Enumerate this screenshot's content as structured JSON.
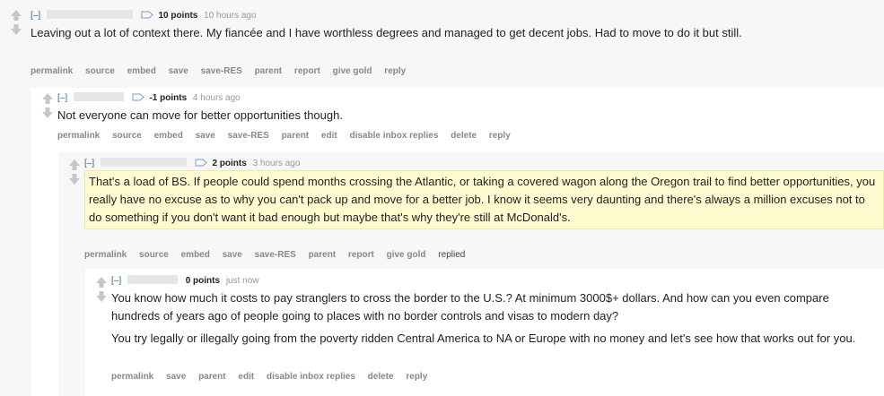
{
  "comments": [
    {
      "collapse": "[–]",
      "points": "10 points",
      "time": "10 hours ago",
      "paragraphs": [
        "Leaving out a lot of context there. My fiancée and I have worthless degrees and managed to get decent jobs. Had to move to do it but still."
      ],
      "buttons": [
        "permalink",
        "source",
        "embed",
        "save",
        "save-RES",
        "parent",
        "report",
        "give gold",
        "reply"
      ]
    },
    {
      "collapse": "[–]",
      "points": "-1 points",
      "time": "4 hours ago",
      "paragraphs": [
        "Not everyone can move for better opportunities though."
      ],
      "buttons": [
        "permalink",
        "source",
        "embed",
        "save",
        "save-RES",
        "parent",
        "edit",
        "disable inbox replies",
        "delete",
        "reply"
      ]
    },
    {
      "collapse": "[–]",
      "points": "2 points",
      "time": "3 hours ago",
      "paragraphs": [
        "That's a load of BS. If people could spend months crossing the Atlantic, or taking a covered wagon along the Oregon trail to find better opportunities, you really have no excuse as to why you can't pack up and move for a better job. I know it seems very daunting and there's always a million excuses not to do something if you don't want it bad enough but maybe that's why they're still at McDonald's."
      ],
      "buttons": [
        "permalink",
        "source",
        "embed",
        "save",
        "save-RES",
        "parent",
        "report",
        "give gold"
      ],
      "status": "replied"
    },
    {
      "collapse": "[–]",
      "points": "0 points",
      "time": "just now",
      "paragraphs": [
        "You know how much it costs to pay stranglers to cross the border to the U.S.? At minimum 3000$+ dollars. And how can you even compare hundreds of years ago of people going to places with no border controls and visas to modern day?",
        "You try legally or illegally going from the poverty ridden Central America to NA or Europe with no money and let's see how that works out for you."
      ],
      "buttons": [
        "permalink",
        "save",
        "parent",
        "edit",
        "disable inbox replies",
        "delete",
        "reply"
      ]
    }
  ],
  "icons": {
    "upvote": "upvote-arrow-icon",
    "downvote": "downvote-arrow-icon",
    "tag": "user-tag-icon"
  },
  "colors": {
    "nested_bg": "#f7f7f8",
    "highlight": "#fffbd0",
    "link": "#888888",
    "collapse": "#336699"
  }
}
